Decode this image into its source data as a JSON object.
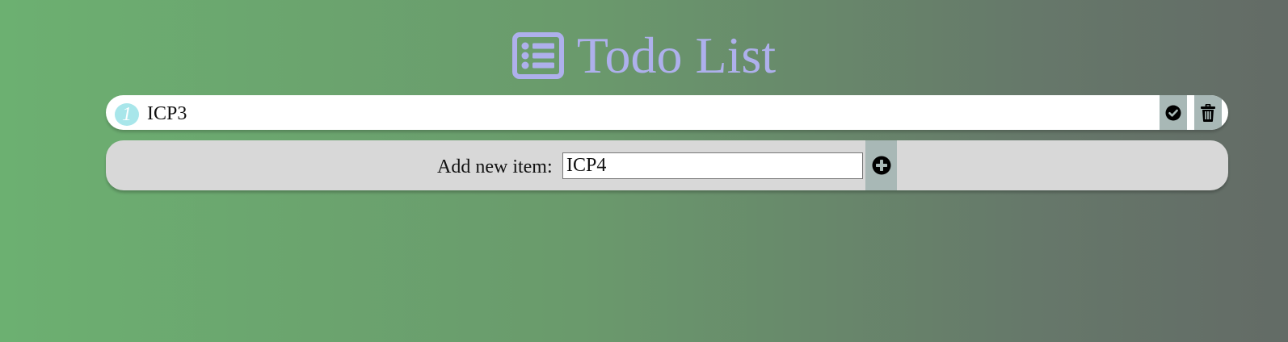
{
  "header": {
    "title": "Todo List",
    "icon": "list-alt-icon",
    "color": "#aeb0ec"
  },
  "todos": [
    {
      "number": "1",
      "text": "ICP3",
      "complete_icon": "check-circle-icon",
      "delete_icon": "trash-icon"
    }
  ],
  "add_form": {
    "label": "Add new item:",
    "input_value": "ICP4",
    "add_icon": "plus-circle-icon"
  },
  "colors": {
    "gradient_start": "#6cb071",
    "gradient_end": "#636b66",
    "number_badge": "#a8e6ea",
    "button_bg": "#a8b8b6",
    "form_bg": "#d8d8d8"
  }
}
